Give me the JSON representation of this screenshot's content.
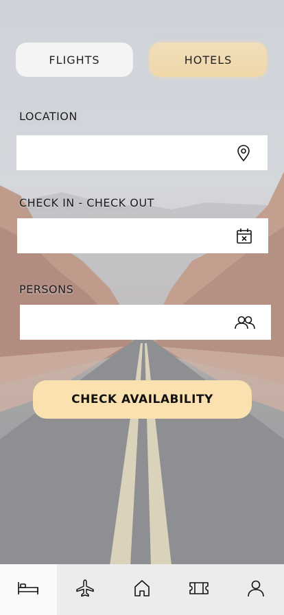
{
  "toggles": {
    "flights_label": "FLIGHTS",
    "hotels_label": "HOTELS",
    "selected": "hotels"
  },
  "form": {
    "location": {
      "label": "LOCATION",
      "value": "",
      "placeholder": "",
      "icon": "map-pin-icon"
    },
    "dates": {
      "label": "CHECK IN - CHECK OUT",
      "value": "",
      "placeholder": "",
      "icon": "calendar-x-icon"
    },
    "persons": {
      "label": "PERSONS",
      "value": "",
      "placeholder": "",
      "icon": "users-icon"
    }
  },
  "cta": {
    "label": "CHECK AVAILABILITY"
  },
  "tabbar": {
    "active": "bed",
    "items": [
      {
        "icon": "bed-icon"
      },
      {
        "icon": "plane-icon"
      },
      {
        "icon": "home-icon"
      },
      {
        "icon": "ticket-icon"
      },
      {
        "icon": "user-icon"
      }
    ]
  },
  "colors": {
    "accent": "#fbe1b0",
    "hotels_toggle": "#efd7a8",
    "tabbar": "#ececec"
  }
}
